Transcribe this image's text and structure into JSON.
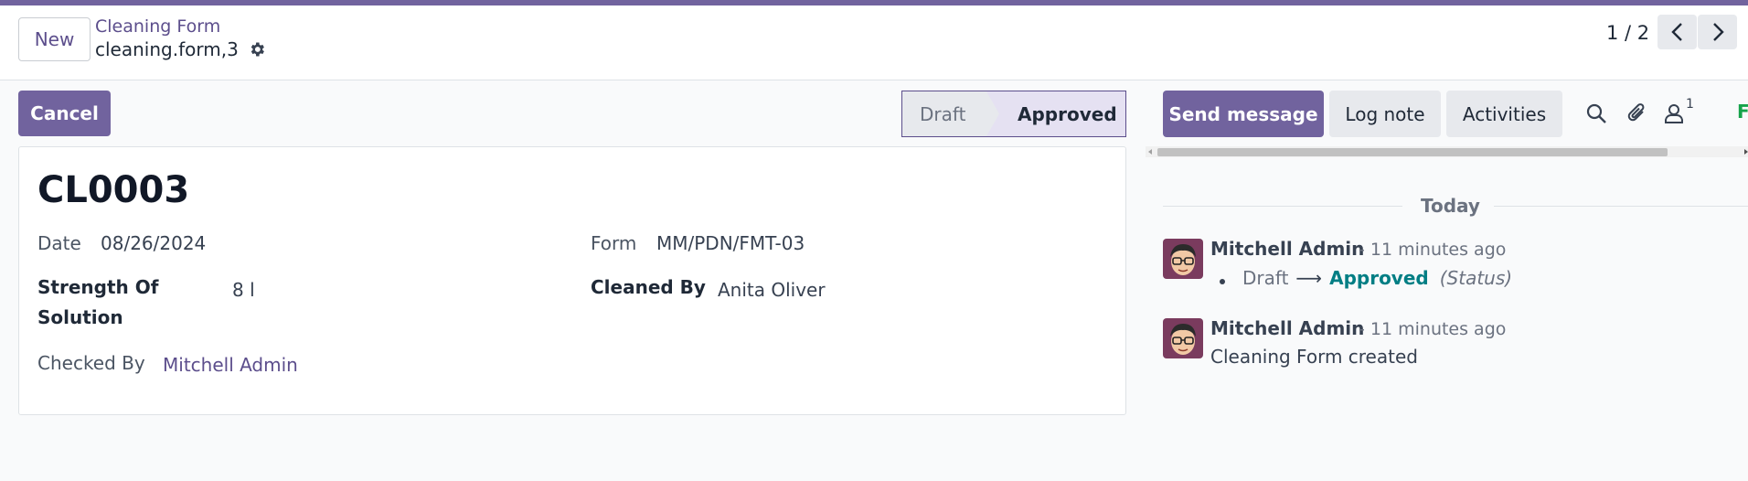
{
  "header": {
    "new_button": "New",
    "breadcrumb_parent": "Cleaning Form",
    "record_ref": "cleaning.form,3",
    "pager_value": "1 / 2"
  },
  "actions": {
    "cancel_button": "Cancel"
  },
  "statusbar": {
    "stages": [
      "Draft",
      "Approved"
    ],
    "current": "Approved"
  },
  "form": {
    "title": "CL0003",
    "date_label": "Date",
    "date_value": "08/26/2024",
    "form_label": "Form",
    "form_value": "MM/PDN/FMT-03",
    "strength_label_line1": "Strength Of",
    "strength_label_line2": "Solution",
    "strength_value": "8 l",
    "cleaned_by_label": "Cleaned By",
    "cleaned_by_value": "Anita Oliver",
    "checked_by_label": "Checked By",
    "checked_by_value": "Mitchell Admin"
  },
  "chatter": {
    "send_message": "Send message",
    "log_note": "Log note",
    "activities": "Activities",
    "follower_count": "1",
    "follow_partial": "F",
    "icons": [
      "search-icon",
      "paperclip-icon",
      "user-icon"
    ],
    "date_separator": "Today",
    "messages": [
      {
        "author": "Mitchell Admin",
        "time": "- 11 minutes ago",
        "tracking_old": "Draft",
        "tracking_arrow": "⟶",
        "tracking_new": "Approved",
        "tracking_field": "(Status)"
      },
      {
        "author": "Mitchell Admin",
        "time": "- 11 minutes ago",
        "body": "Cleaning Form created"
      }
    ]
  },
  "colors": {
    "brand": "#71639e",
    "link": "#5c4e8c",
    "tracking_new": "#017e84",
    "follow": "#16a34a"
  }
}
